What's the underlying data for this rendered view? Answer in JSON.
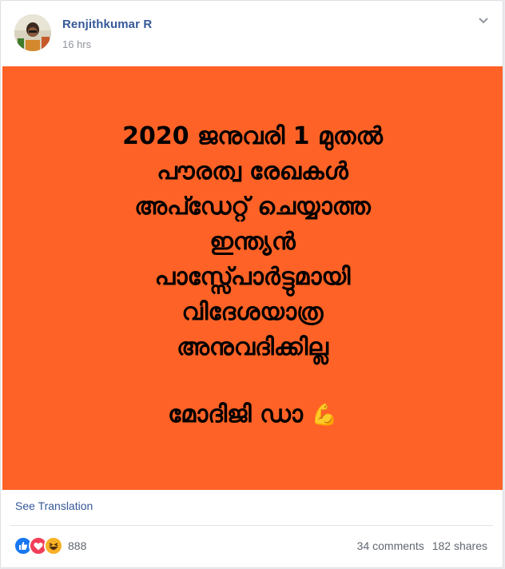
{
  "post": {
    "author": "Renjithkumar R",
    "timestamp": "16 hrs",
    "image_text": {
      "lines": [
        "2020 ജനുവരി 1 മുതൽ",
        "പൗരത്വ രേഖകൾ",
        "അപ്ഡേറ്റ് ചെയ്യാത്ത",
        "ഇന്ത്യൻ",
        "പാസ്സ്പോർട്ടുമായി",
        "വിദേശയാത്ര",
        "അനുവദിക്കില്ല"
      ],
      "closing": "മോദിജി ഡാ",
      "closing_emoji": "💪",
      "background_color": "#ff6226"
    },
    "translation_link": "See Translation",
    "reactions": {
      "types": [
        "like-icon",
        "love-icon",
        "haha-icon"
      ],
      "count": "888"
    },
    "comments": "34 comments",
    "shares": "182 shares"
  },
  "colors": {
    "link": "#365899",
    "meta": "#90949c",
    "like": "#1877f2",
    "love": "#f33e58",
    "haha": "#f7b125"
  }
}
